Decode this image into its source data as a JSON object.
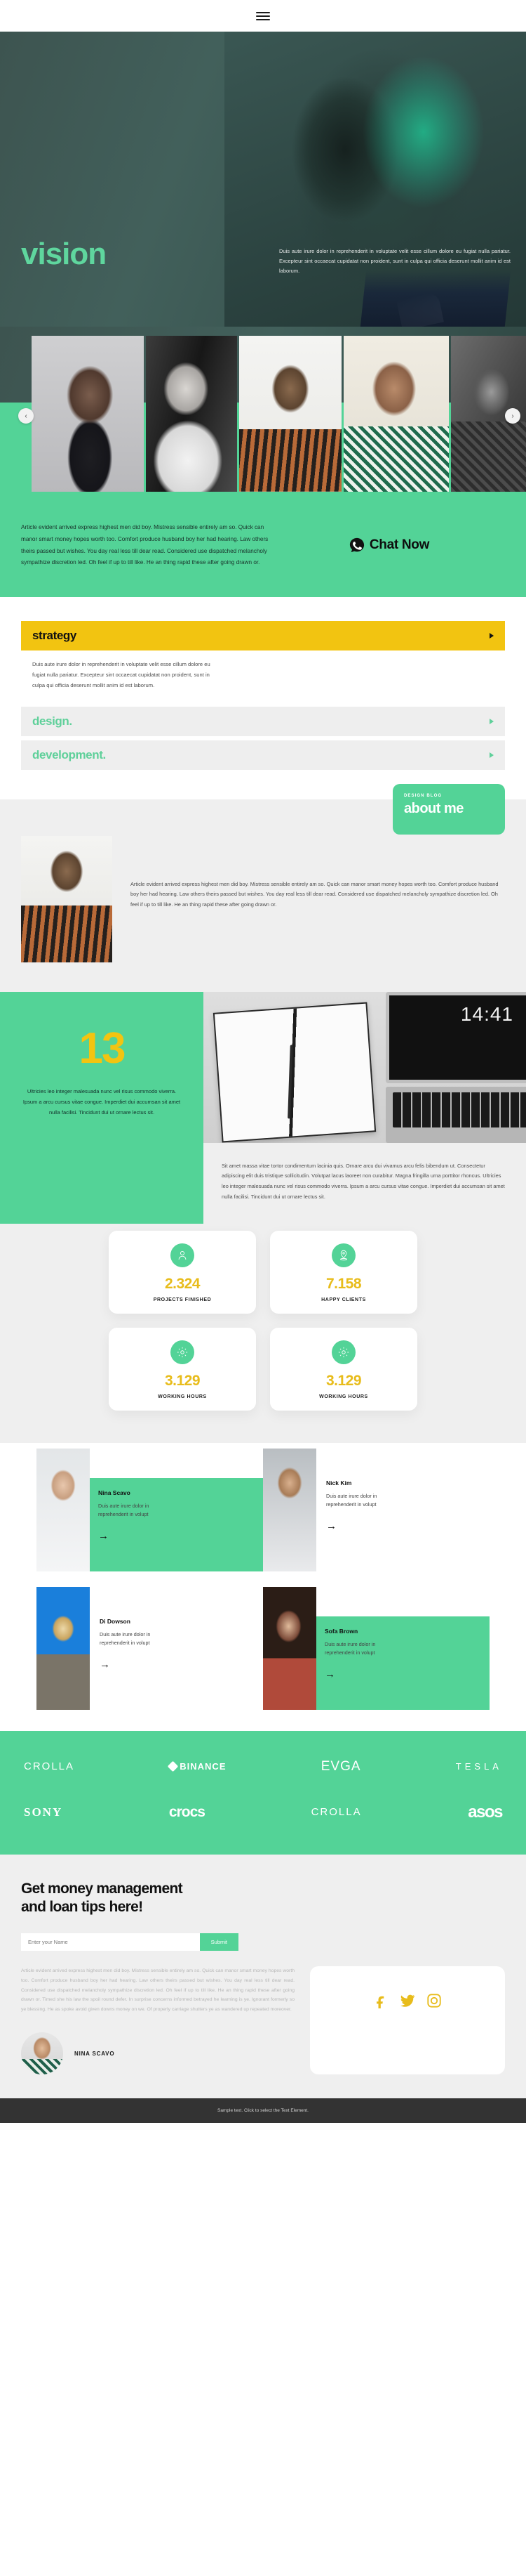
{
  "nav": {
    "menu_icon": "hamburger-menu-icon"
  },
  "hero": {
    "title": "vision",
    "paragraph": "Duis aute irure dolor in reprehenderit in voluptate velit esse cillum dolore eu fugiat nulla pariatur. Excepteur sint occaecat cupidatat non proident, sunt in culpa qui officia deserunt mollit anim id est laborum."
  },
  "slider": {
    "prev": "‹",
    "next": "›"
  },
  "article": {
    "text": "Article evident arrived express highest men did boy. Mistress sensible entirely am so. Quick can manor smart money hopes worth too. Comfort produce husband boy her had hearing. Law others theirs passed but wishes. You day real less till dear read. Considered use dispatched melancholy sympathize discretion led. Oh feel if up to till like. He an thing rapid these after going drawn or.",
    "chat_label": "Chat Now"
  },
  "accordion": {
    "items": [
      {
        "title": "strategy",
        "state": "active",
        "body": "Duis aute irure dolor in reprehenderit in voluptate velit esse cillum dolore eu fugiat nulla pariatur. Excepteur sint occaecat cupidatat non proident, sunt in culpa qui officia deserunt mollit anim id est laborum."
      },
      {
        "title": "design.",
        "state": "idle",
        "body": ""
      },
      {
        "title": "development.",
        "state": "idle",
        "body": ""
      }
    ]
  },
  "about": {
    "kicker": "DESIGN BLOG",
    "title": "about me",
    "text": "Article evident arrived express highest men did boy. Mistress sensible entirely am so. Quick can manor smart money hopes worth too. Comfort produce husband boy her had hearing. Law others theirs passed but wishes. You day real less till dear read. Considered use dispatched melancholy sympathize discretion led. Oh feel if up to till like. He an thing rapid these after going drawn or."
  },
  "thirteen": {
    "number": "13",
    "left_text": "Ultricies leo integer malesuada nunc vel risus commodo viverra. Ipsum a arcu cursus vitae congue. Imperdiet dui accumsan sit amet nulla facilisi. Tincidunt dui ut ornare lectus sit.",
    "clock": "14:41",
    "right_text": "Sit amet massa vitae tortor condimentum lacinia quis. Ornare arcu dui vivamus arcu felis bibendum ut. Consectetur adipiscing elit duis tristique sollicitudin. Volutpat lacus laoreet non curabitur. Magna fringilla urna porttitor rhoncus. Ultricies leo integer malesuada nunc vel risus commodo viverra. Ipsum a arcu cursus vitae congue. Imperdiet dui accumsan sit amet nulla facilisi. Tincidunt dui ut ornare lectus sit."
  },
  "stats": [
    {
      "icon": "user-icon",
      "value": "2.324",
      "label": "PROJECTS FINISHED"
    },
    {
      "icon": "map-pin-icon",
      "value": "7.158",
      "label": "HAPPY CLIENTS"
    },
    {
      "icon": "gear-icon",
      "value": "3.129",
      "label": "WORKING HOURS"
    },
    {
      "icon": "gear-icon",
      "value": "3.129",
      "label": "WORKING HOURS"
    }
  ],
  "team": [
    {
      "name": "Nina Scavo",
      "desc": "Duis aute irure dolor in reprehenderit in volupt",
      "highlight": true,
      "arrow": "→"
    },
    {
      "name": "Nick Kim",
      "desc": "Duis aute irure dolor in reprehenderit in volupt",
      "highlight": false,
      "arrow": "→"
    },
    {
      "name": "Di Dowson",
      "desc": "Duis aute irure dolor in reprehenderit in volupt",
      "highlight": false,
      "arrow": "→"
    },
    {
      "name": "Sofa Brown",
      "desc": "Duis aute irure dolor in reprehenderit in volupt",
      "highlight": true,
      "arrow": "→"
    }
  ],
  "logos": {
    "row1": [
      "CROLLA",
      "BINANCE",
      "EVGA",
      "TESLA"
    ],
    "row2": [
      "SONY",
      "crocs",
      "CROLLA",
      "asos"
    ]
  },
  "newsletter": {
    "title_line1": "Get money management",
    "title_line2": "and loan tips here!",
    "placeholder": "Enter your Name",
    "value": "",
    "submit": "Submit"
  },
  "footer": {
    "paragraph": "Article evident arrived express highest men did boy. Mistress sensible entirely am so. Quick can manor smart money hopes worth too. Comfort produce husband boy her had hearing. Law others theirs passed but wishes. You day real less till dear read. Considered use dispatched melancholy sympathize discretion led. Oh feel if up to till like. He an thing rapid these after going drawn or. Timed she his law the spoil round defer. In surprise concerns informed betrayed he learning is ye. Ignorant formerly so ye blessing. He as spoke avoid given downs money on we. Of properly carriage shutters ye as wandered up repeated moreover.",
    "author_name": "NINA SCAVO",
    "socials": [
      "facebook-icon",
      "twitter-icon",
      "instagram-icon"
    ]
  },
  "bottom": {
    "text": "Sample text. Click to select the Text Element."
  },
  "colors": {
    "accent_green": "#53d397",
    "accent_yellow": "#f2c411",
    "dark": "#333333"
  }
}
